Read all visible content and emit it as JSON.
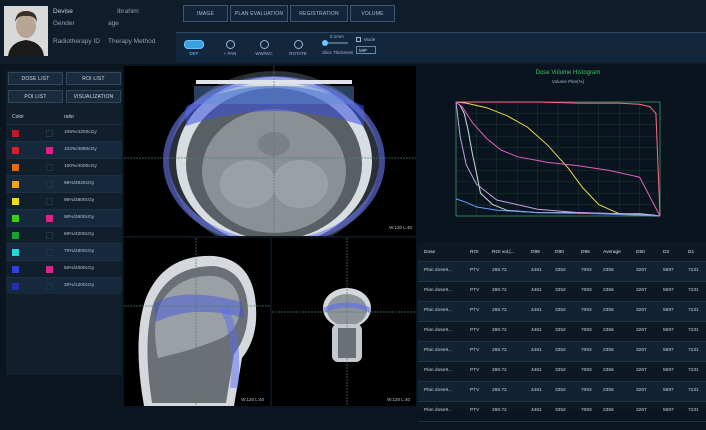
{
  "patient": {
    "name_label": "Devise",
    "name_value": "Ibrahim",
    "gender_label": "Gender",
    "age_label": "age",
    "rt_id_label": "Radiotherapy ID",
    "therapy_label": "Therapy Method"
  },
  "nav": {
    "tabs": [
      "IMAGE",
      "PLAN EVALUATION",
      "REGISTRATION",
      "VOLUME"
    ]
  },
  "toolbar": {
    "tools": [
      "DEF",
      "+ PAN",
      "WW/WC",
      "ROTATE"
    ],
    "slice_label": "0.1mm",
    "slice_thickness_label": "Slice Thickness",
    "mode_label": "Mode",
    "select_value": "MIP"
  },
  "left_panel": {
    "buttons": [
      "DOSE LIST",
      "ROI LIST",
      "POI LIST",
      "VISUALIZATION"
    ],
    "col_color": "Color",
    "col_ratio": "ratio",
    "rows": [
      {
        "color": "#c0182a",
        "color2": "",
        "ratio": "105%/4200cGy"
      },
      {
        "color": "#d2202e",
        "color2": "#e0208a",
        "ratio": "102%/4080cGy"
      },
      {
        "color": "#e06a10",
        "color2": "",
        "ratio": "100%/4000cGy"
      },
      {
        "color": "#f0a410",
        "color2": "",
        "ratio": "98%/3920cGy"
      },
      {
        "color": "#e8e010",
        "color2": "",
        "ratio": "95%/3800cGy"
      },
      {
        "color": "#3ad018",
        "color2": "#e0208a",
        "ratio": "90%/3600cGy"
      },
      {
        "color": "#18a030",
        "color2": "",
        "ratio": "80%/3200cGy"
      },
      {
        "color": "#20d8d8",
        "color2": "",
        "ratio": "70%/2800cGy"
      },
      {
        "color": "#3040e0",
        "color2": "#e0208a",
        "ratio": "50%/2000cGy"
      },
      {
        "color": "#2030b0",
        "color2": "",
        "ratio": "30%/1200cGy"
      }
    ]
  },
  "viewports": {
    "axial_wl": "W:120 L:40",
    "sagittal_wl": "W:120 L:40",
    "coronal_wl": "W:120 L:40"
  },
  "chart_data": {
    "type": "line",
    "title": "Dose Volume Histogram",
    "subtitle": "Volume Plan(%)",
    "xlabel": "",
    "ylabel": "",
    "xlim": [
      0,
      100
    ],
    "ylim": [
      0,
      100
    ],
    "grid": true,
    "series": [
      {
        "color": "#e8d84a",
        "x": [
          0,
          5,
          15,
          25,
          35,
          45,
          55,
          62,
          70,
          80,
          100
        ],
        "y": [
          100,
          99,
          95,
          88,
          78,
          62,
          42,
          25,
          10,
          2,
          0
        ]
      },
      {
        "color": "#d5d9e0",
        "x": [
          0,
          2,
          4,
          6,
          8,
          10,
          12,
          18,
          25,
          40,
          60,
          80,
          90,
          96,
          100
        ],
        "y": [
          100,
          97,
          90,
          75,
          55,
          38,
          20,
          10,
          5,
          3,
          3,
          2,
          2,
          1,
          0
        ]
      },
      {
        "color": "#c8a0e8",
        "x": [
          0,
          2,
          5,
          10,
          20,
          40,
          60,
          80,
          95,
          98,
          100
        ],
        "y": [
          100,
          70,
          45,
          28,
          14,
          6,
          3,
          2,
          1,
          0,
          0
        ]
      },
      {
        "color": "#ff6a8a",
        "x": [
          0,
          5,
          20,
          40,
          60,
          80,
          90,
          95,
          98,
          100
        ],
        "y": [
          100,
          100,
          100,
          100,
          99,
          99,
          98,
          96,
          90,
          0
        ]
      },
      {
        "color": "#e060c0",
        "x": [
          0,
          3,
          8,
          15,
          22,
          30,
          45,
          60,
          75,
          90,
          100
        ],
        "y": [
          100,
          96,
          82,
          68,
          58,
          52,
          47,
          44,
          40,
          34,
          0
        ]
      },
      {
        "color": "#6aa0ff",
        "x": [
          0,
          5,
          10,
          20,
          40,
          70,
          100
        ],
        "y": [
          15,
          12,
          8,
          5,
          3,
          2,
          0
        ]
      }
    ]
  },
  "table": {
    "headers": [
      "Dose",
      "ROI",
      "ROI vol.[...",
      "D99",
      "D90",
      "D95",
      "Average",
      "D50",
      "D2",
      "D1"
    ],
    "rows": [
      [
        "Plan dose9...",
        "PTV",
        "298.72",
        "4461",
        "3352",
        "7083",
        "2356",
        "3267",
        "5597",
        "7231"
      ],
      [
        "Plan dose9...",
        "PTV",
        "298.72",
        "4461",
        "3352",
        "7083",
        "2356",
        "3267",
        "5597",
        "7231"
      ],
      [
        "Plan dose9...",
        "PTV",
        "298.72",
        "4461",
        "3352",
        "7083",
        "2356",
        "3267",
        "5597",
        "7231"
      ],
      [
        "Plan dose9...",
        "PTV",
        "298.72",
        "4461",
        "3352",
        "7083",
        "2356",
        "3267",
        "5597",
        "7231"
      ],
      [
        "Plan dose9...",
        "PTV",
        "298.72",
        "4461",
        "3352",
        "7083",
        "2356",
        "3267",
        "5597",
        "7231"
      ],
      [
        "Plan dose9...",
        "PTV",
        "298.72",
        "4461",
        "3352",
        "7083",
        "2356",
        "3267",
        "5597",
        "7231"
      ],
      [
        "Plan dose9...",
        "PTV",
        "298.72",
        "4461",
        "3352",
        "7083",
        "2356",
        "3267",
        "5597",
        "7231"
      ],
      [
        "Plan dose9...",
        "PTV",
        "298.72",
        "4461",
        "3352",
        "7083",
        "2356",
        "3267",
        "5597",
        "7231"
      ]
    ]
  }
}
